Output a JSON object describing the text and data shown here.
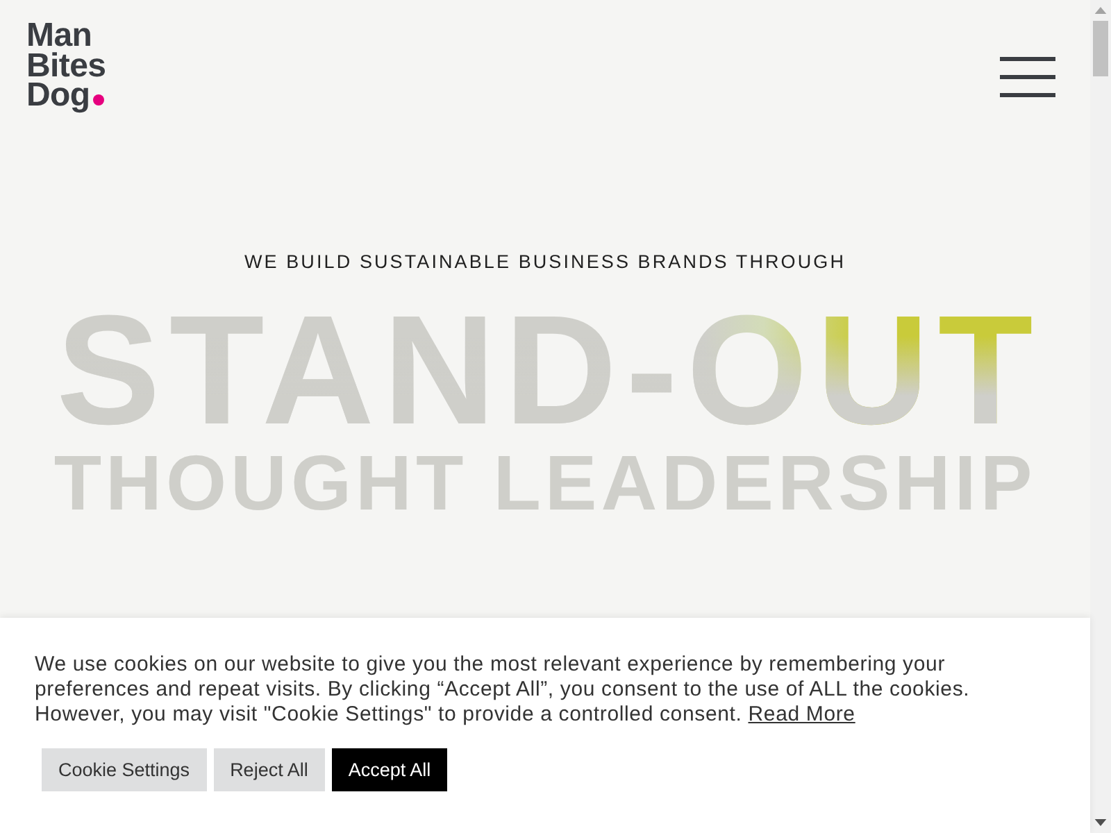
{
  "logo": {
    "lines": [
      "Man",
      "Bites",
      "Dog"
    ]
  },
  "hero": {
    "tagline": "WE BUILD SUSTAINABLE BUSINESS BRANDS THROUGH",
    "headline": "STAND-OUT",
    "subheadline": "THOUGHT LEADERSHIP"
  },
  "cookie_banner": {
    "message": "We use cookies on our website to give you the most relevant experience by remembering your preferences and repeat visits. By clicking “Accept All”, you consent to the use of ALL the cookies. However, you may visit \"Cookie Settings\" to provide a controlled consent.",
    "link": "Read More",
    "buttons": [
      {
        "label": "Cookie Settings",
        "kind": "secondary"
      },
      {
        "label": "Reject All",
        "kind": "secondary"
      },
      {
        "label": "Accept All",
        "kind": "primary"
      }
    ]
  }
}
